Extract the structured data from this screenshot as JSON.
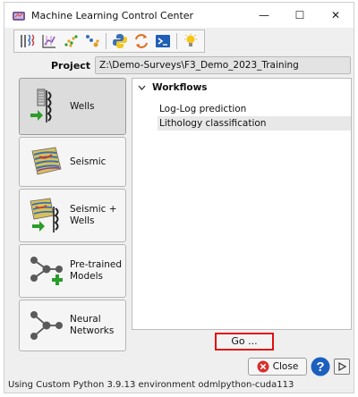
{
  "window": {
    "title": "Machine Learning Control Center",
    "controls": {
      "minimize": "—",
      "maximize": "☐",
      "close": "✕"
    }
  },
  "toolbar": {
    "icons": [
      "wells-logs-icon",
      "crossplot-icon",
      "scatter-icon",
      "cluster-icon",
      "python-icon",
      "refresh-icon",
      "terminal-icon",
      "lightbulb-icon"
    ]
  },
  "project": {
    "label": "Project",
    "path": "Z:\\Demo-Surveys\\F3_Demo_2023_Training"
  },
  "sidebar": {
    "items": [
      {
        "label": "Wells",
        "active": true
      },
      {
        "label": "Seismic",
        "active": false
      },
      {
        "label": "Seismic +\nWells",
        "active": false
      },
      {
        "label": "Pre-trained\nModels",
        "active": false
      },
      {
        "label": "Neural\nNetworks",
        "active": false
      }
    ]
  },
  "workflows": {
    "header": "Workflows",
    "items": [
      "Log-Log prediction",
      "Lithology classification"
    ],
    "selected_index": 1
  },
  "buttons": {
    "go": "Go ...",
    "close": "Close"
  },
  "status": "Using Custom Python 3.9.13 environment odmlpython-cuda113",
  "colors": {
    "highlight_border": "#e01010",
    "close_icon": "#d9302c",
    "help_icon": "#1c5fbf",
    "arrow_green": "#2a9d2a"
  }
}
